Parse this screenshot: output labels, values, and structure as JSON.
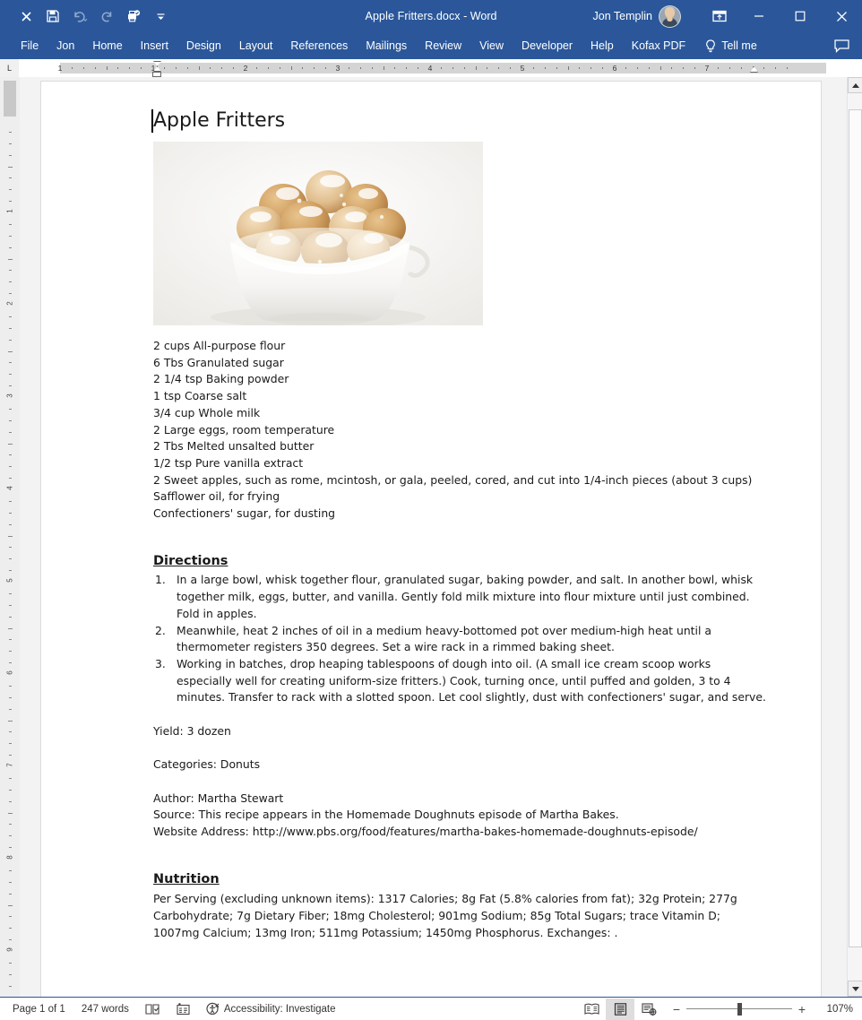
{
  "titlebar": {
    "doc_name": "Apple Fritters.docx",
    "app_separator": "-",
    "app_name": "Word",
    "user_name": "Jon Templin",
    "quick_access": [
      {
        "name": "close-document",
        "label": "×"
      },
      {
        "name": "save",
        "label": "save-icon"
      },
      {
        "name": "undo",
        "label": "undo-icon"
      },
      {
        "name": "redo",
        "label": "redo-icon"
      },
      {
        "name": "print-preview",
        "label": "print-icon"
      },
      {
        "name": "customize-qat",
        "label": "chevron-down-icon"
      }
    ],
    "window_controls": {
      "ribbon_display": "ribbon-display-options-icon",
      "minimize": "—",
      "maximize": "☐",
      "close": "✕"
    }
  },
  "ribbon": {
    "tabs": [
      {
        "label": "File"
      },
      {
        "label": "Jon"
      },
      {
        "label": "Home"
      },
      {
        "label": "Insert"
      },
      {
        "label": "Design"
      },
      {
        "label": "Layout"
      },
      {
        "label": "References"
      },
      {
        "label": "Mailings"
      },
      {
        "label": "Review"
      },
      {
        "label": "View"
      },
      {
        "label": "Developer"
      },
      {
        "label": "Help"
      },
      {
        "label": "Kofax PDF"
      }
    ],
    "tell_me": "Tell me",
    "comment_icon": "comment-icon"
  },
  "ruler": {
    "tab_selector": "L",
    "numbers": [
      "1",
      "1",
      "2",
      "3",
      "4",
      "5",
      "6",
      "7"
    ],
    "vertical_numbers": [
      "1",
      "2",
      "3",
      "4",
      "5",
      "6",
      "7",
      "8",
      "9"
    ]
  },
  "document": {
    "title": "Apple Fritters",
    "image_alt": "apple-fritters-photo",
    "ingredients": [
      "2 cups All-purpose flour",
      "6 Tbs Granulated sugar",
      "2 1/4 tsp Baking powder",
      "1 tsp Coarse salt",
      "3/4 cup Whole milk",
      "2 Large eggs, room temperature",
      "2 Tbs Melted unsalted butter",
      "1/2 tsp Pure vanilla extract",
      "2 Sweet apples, such as rome, mcintosh, or gala, peeled, cored, and cut into 1/4-inch pieces (about 3 cups)",
      "Safflower oil, for frying",
      "Confectioners' sugar, for dusting"
    ],
    "directions_heading": "Directions",
    "directions": [
      "In a large bowl, whisk together flour, granulated sugar, baking powder, and salt. In another bowl, whisk together milk, eggs, butter, and vanilla. Gently fold milk mixture into flour mixture until just combined. Fold in apples.",
      "Meanwhile, heat 2 inches of oil in a medium heavy-bottomed pot over medium-high heat until a thermometer registers 350 degrees. Set a wire rack in a rimmed baking sheet.",
      "Working in batches, drop heaping tablespoons of dough into oil. (A small ice cream scoop works especially well for creating uniform-size fritters.) Cook, turning once, until puffed and golden, 3 to 4 minutes. Transfer to rack with a slotted spoon. Let cool slightly, dust with confectioners' sugar, and serve."
    ],
    "yield": "Yield: 3 dozen",
    "categories": "Categories: Donuts",
    "author": "Author: Martha Stewart",
    "source": "Source: This recipe appears in the Homemade Doughnuts episode of Martha Bakes.",
    "website": "Website Address: http://www.pbs.org/food/features/martha-bakes-homemade-doughnuts-episode/",
    "nutrition_heading": "Nutrition",
    "nutrition_text": "Per Serving (excluding unknown items): 1317 Calories; 8g Fat (5.8% calories from fat); 32g Protein; 277g Carbohydrate; 7g Dietary Fiber; 18mg Cholesterol; 901mg Sodium; 85g Total Sugars; trace Vitamin D; 1007mg Calcium; 13mg Iron; 511mg Potassium; 1450mg Phosphorus.  Exchanges: ."
  },
  "statusbar": {
    "page": "Page 1 of 1",
    "words": "247 words",
    "proofing_icon": "proofing-errors-icon",
    "language_icon": "language-icon",
    "accessibility_icon": "accessibility-icon",
    "accessibility": "Accessibility: Investigate",
    "view_read": "read-mode-icon",
    "view_print": "print-layout-icon",
    "view_web": "web-layout-icon",
    "zoom_out": "−",
    "zoom_in": "+",
    "zoom_level": "107%"
  },
  "colors": {
    "word_blue": "#2b579a",
    "page_bg": "#f3f3f3"
  }
}
